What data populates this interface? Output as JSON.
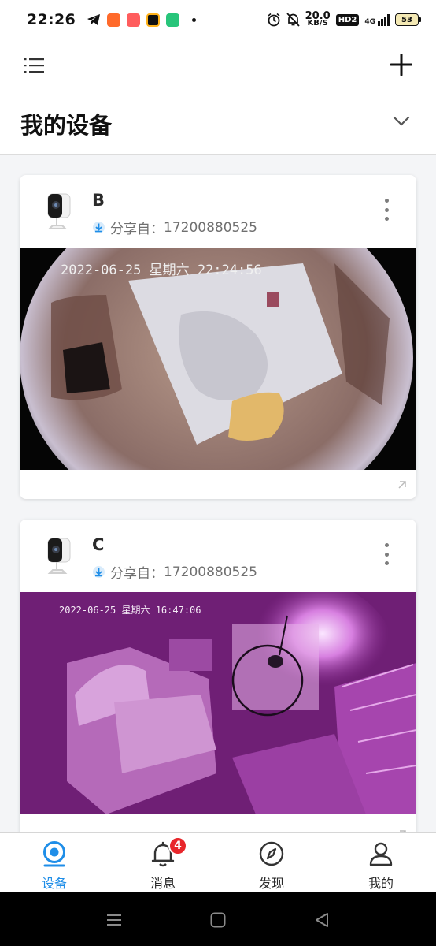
{
  "status_bar": {
    "time": "22:26",
    "net_speed_value": "20.0",
    "net_speed_unit": "KB/S",
    "hd_label": "HD2",
    "network_label": "4G",
    "battery": "53",
    "app_colors": [
      "#ff6a2b",
      "#ff5d5d",
      "#111111",
      "#28c57a"
    ]
  },
  "header": {
    "menu_icon": "list-icon",
    "add_icon": "plus-icon",
    "title": "我的设备",
    "collapse_icon": "chevron-down-icon"
  },
  "devices": [
    {
      "name": "B",
      "share_label": "分享自：",
      "share_from": "17200880525",
      "feed_timestamp": "2022-06-25 星期六 22:24:56",
      "feed_mode": "day"
    },
    {
      "name": "C",
      "share_label": "分享自：",
      "share_from": "17200880525",
      "feed_timestamp": "2022-06-25 星期六 16:47:06",
      "feed_mode": "night"
    }
  ],
  "bottom_nav": {
    "active": "设备",
    "accent_color": "#1f8ee8",
    "items": [
      {
        "label": "设备",
        "icon": "camera-icon"
      },
      {
        "label": "消息",
        "icon": "bell-icon",
        "badge": "4"
      },
      {
        "label": "发现",
        "icon": "compass-icon"
      },
      {
        "label": "我的",
        "icon": "user-icon"
      }
    ]
  }
}
